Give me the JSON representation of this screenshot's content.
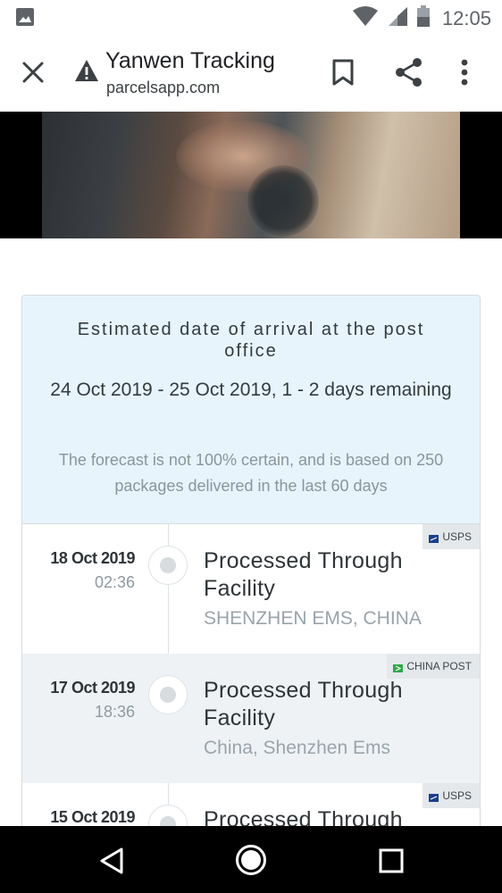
{
  "status_bar": {
    "time": "12:05",
    "icons": [
      "gallery-icon",
      "wifi-icon",
      "signal-icon",
      "battery-icon"
    ]
  },
  "browser": {
    "title": "Yanwen Tracking",
    "domain": "parcelsapp.com",
    "icons": [
      "close-icon",
      "warning-icon",
      "bookmark-icon",
      "share-icon",
      "more-icon"
    ]
  },
  "estimate": {
    "heading": "Estimated date of arrival at the post office",
    "dates": "24 Oct 2019 - 25 Oct 2019, 1 - 2 days remaining",
    "note": "The forecast is not 100% certain, and is based on 250 packages delivered in the last 60 days"
  },
  "events": [
    {
      "date": "18 Oct 2019",
      "time": "02:36",
      "status": "Processed Through Facility",
      "location": "SHENZHEN EMS, CHINA",
      "carrier": "USPS"
    },
    {
      "date": "17 Oct 2019",
      "time": "18:36",
      "status": "Processed Through Facility",
      "location": "China, Shenzhen Ems",
      "carrier": "CHINA POST"
    },
    {
      "date": "15 Oct 2019",
      "time": "",
      "status": "Processed Through",
      "location": "",
      "carrier": "USPS"
    }
  ],
  "colors": {
    "estimate_bg": "#e7f4fc",
    "alt_row_bg": "#eef2f5",
    "china_post_flag": "#2ea84a",
    "usps_flag": "#1c3f8c"
  },
  "nav_bar": {
    "icons": [
      "back-icon",
      "home-icon",
      "recents-icon"
    ]
  }
}
